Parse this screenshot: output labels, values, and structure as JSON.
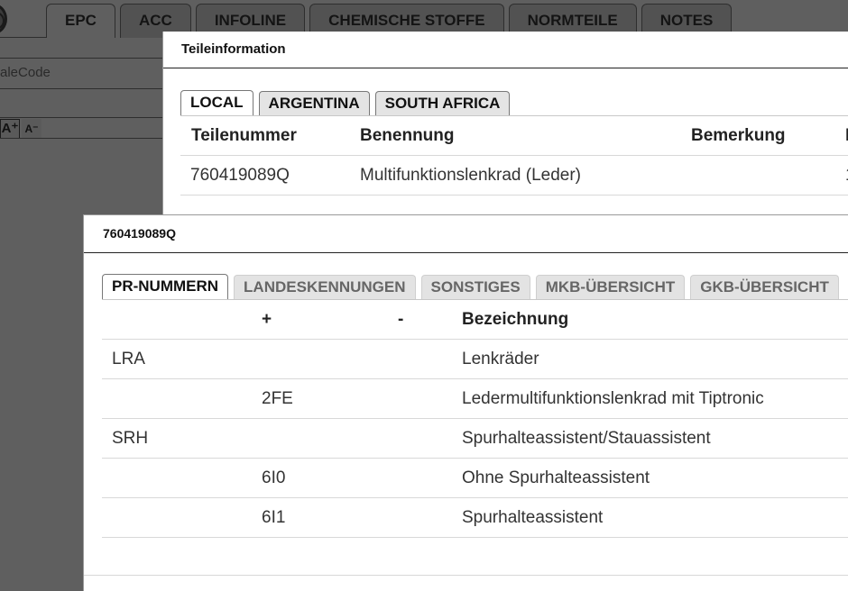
{
  "background": {
    "tabs": [
      "EPC",
      "ACC",
      "INFOLINE",
      "CHEMISCHE STOFFE",
      "NORMTEILE",
      "NOTES"
    ],
    "hint_text": "aleCode",
    "font_buttons": [
      "A⁺",
      "A⁻"
    ]
  },
  "teileinformation": {
    "title": "Teileinformation",
    "tabs": [
      "LOCAL",
      "ARGENTINA",
      "SOUTH AFRICA"
    ],
    "columns": [
      "Teilenummer",
      "Benennung",
      "Bemerkung",
      "I"
    ],
    "rows": [
      {
        "teilenummer": "760419089Q",
        "benennung": "Multifunktionslenkrad (Leder)",
        "bemerkung": "",
        "extra": "1"
      }
    ]
  },
  "part_detail": {
    "title": "760419089Q",
    "tabs": [
      "PR-NUMMERN",
      "LANDESKENNUNGEN",
      "SONSTIGES",
      "MKB-ÜBERSICHT",
      "GKB-ÜBERSICHT"
    ],
    "columns": [
      "",
      "+",
      "-",
      "Bezeichnung"
    ],
    "rows": [
      {
        "family": "LRA",
        "plus": "",
        "minus": "",
        "bezeichnung": "Lenkräder"
      },
      {
        "family": "",
        "plus": "2FE",
        "minus": "",
        "bezeichnung": "Ledermultifunktionslenkrad mit Tiptronic"
      },
      {
        "family": "SRH",
        "plus": "",
        "minus": "",
        "bezeichnung": "Spurhalteassistent/Stauassistent"
      },
      {
        "family": "",
        "plus": "6I0",
        "minus": "",
        "bezeichnung": "Ohne Spurhalteassistent"
      },
      {
        "family": "",
        "plus": "6I1",
        "minus": "",
        "bezeichnung": "Spurhalteassistent"
      }
    ]
  }
}
